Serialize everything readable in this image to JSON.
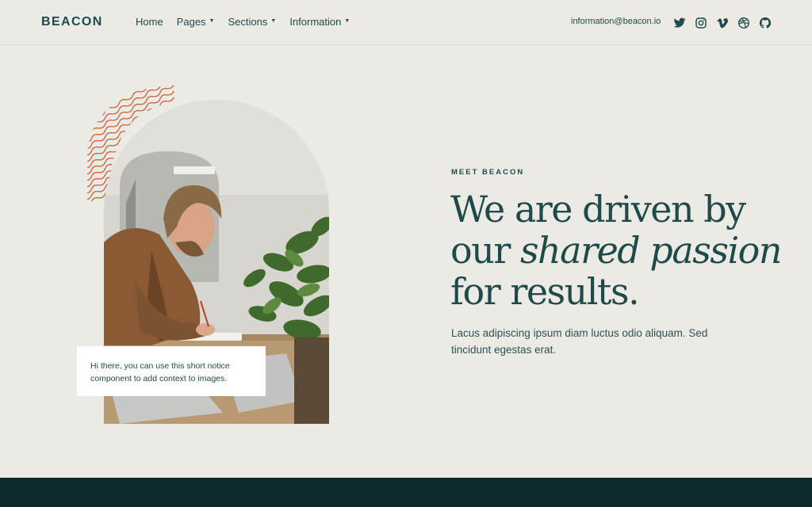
{
  "nav": {
    "brand": "BEACON",
    "links": [
      {
        "label": "Home",
        "has_caret": false
      },
      {
        "label": "Pages",
        "has_caret": true
      },
      {
        "label": "Sections",
        "has_caret": true
      },
      {
        "label": "Information",
        "has_caret": true
      }
    ],
    "email": "information@beacon.io",
    "social_icons": [
      "twitter-icon",
      "instagram-icon",
      "vimeo-icon",
      "dribbble-icon",
      "github-icon"
    ]
  },
  "hero": {
    "eyebrow": "MEET BEACON",
    "headline_line1": "We are driven by",
    "headline_line2_plain": "our ",
    "headline_line2_italic": "shared passion",
    "headline_line3": "for results.",
    "lead": "Lacus adipiscing ipsum diam luctus odio aliquam. Sed tincidunt egestas erat.",
    "notice": "Hi there, you can use this short notice component to add context to images."
  },
  "colors": {
    "background": "#eceae5",
    "text": "#1f4a4a",
    "accent_waves": "#c9643a",
    "footer": "#0e2a2c"
  }
}
